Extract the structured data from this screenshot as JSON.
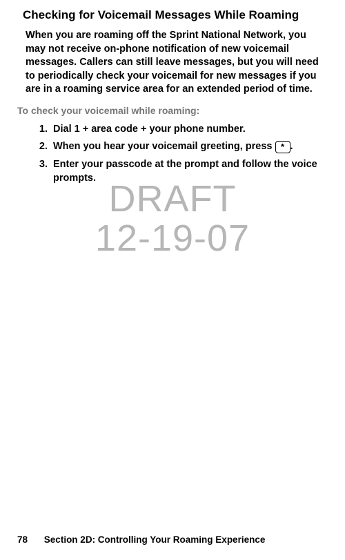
{
  "heading": "Checking for Voicemail Messages While Roaming",
  "intro": "When you are roaming off the Sprint National Network, you may not receive on-phone notification of new voicemail messages. Callers can still leave messages, but you will need to periodically check your voicemail for new messages if you are in a roaming service area for an extended period of time.",
  "subhead": "To check your voicemail while roaming:",
  "steps": [
    {
      "num": "1.",
      "text": "Dial 1 + area code + your phone number."
    },
    {
      "num": "2.",
      "before": "When you hear your voicemail greeting, press ",
      "key": "*",
      "after": "."
    },
    {
      "num": "3.",
      "text": "Enter your passcode at the prompt and follow the voice prompts."
    }
  ],
  "watermark_line1": "DRAFT",
  "watermark_line2": "12-19-07",
  "footer_page": "78",
  "footer_section": "Section 2D: Controlling Your Roaming Experience"
}
